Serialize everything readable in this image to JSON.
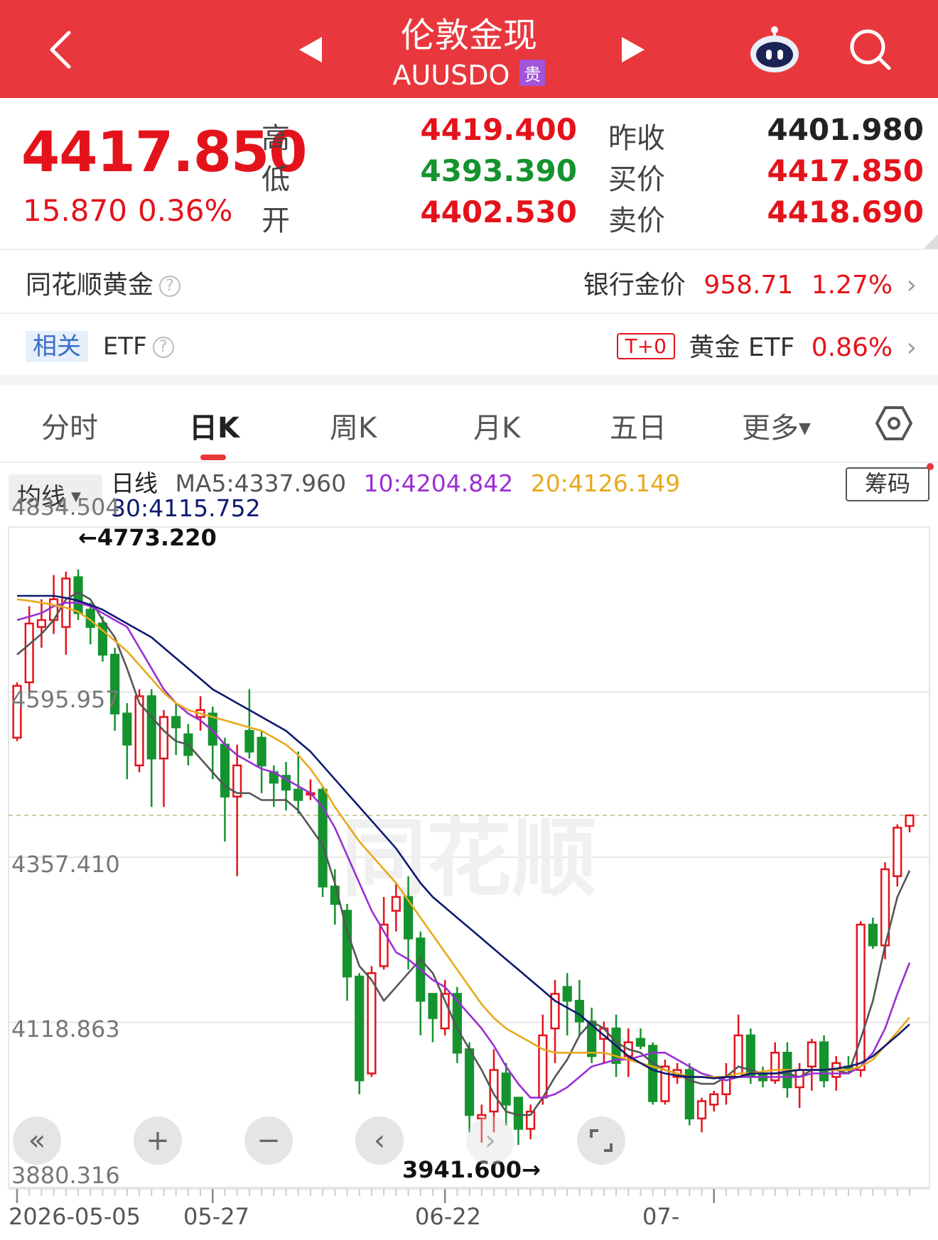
{
  "header": {
    "title": "伦敦金现",
    "symbol": "AUUSDO",
    "tag": "贵"
  },
  "quote": {
    "price": "4417.850",
    "change": "15.870",
    "change_pct": "0.36%",
    "high_label": "高",
    "high": "4419.400",
    "low_label": "低",
    "low": "4393.390",
    "open_label": "开",
    "open": "4402.530",
    "prev_close_label": "昨收",
    "prev_close": "4401.980",
    "bid_label": "买价",
    "bid": "4417.850",
    "ask_label": "卖价",
    "ask": "4418.690"
  },
  "gold_row": {
    "label": "同花顺黄金",
    "bank_label": "银行金价",
    "bank_price": "958.71",
    "bank_pct": "1.27%"
  },
  "etf_row": {
    "tag": "相关",
    "label": "ETF",
    "t0_tag": "T+0",
    "gold_etf_label": "黄金 ETF",
    "gold_etf_pct": "0.86%"
  },
  "tabs": [
    {
      "label": "分时",
      "active": false
    },
    {
      "label": "日K",
      "active": true
    },
    {
      "label": "周K",
      "active": false
    },
    {
      "label": "月K",
      "active": false
    },
    {
      "label": "五日",
      "active": false
    },
    {
      "label": "更多",
      "active": false
    }
  ],
  "chart_header": {
    "ma_selector": "均线",
    "line_label": "日线",
    "ma5": "MA5:4337.960",
    "ma10": "10:4204.842",
    "ma20": "20:4126.149",
    "ma30": "30:4115.752",
    "chips_button": "筹码"
  },
  "colors": {
    "up": "#e4131b",
    "down": "#14932e",
    "header": "#e8383d",
    "ma5": "#555555",
    "ma10": "#9b2fd3",
    "ma20": "#e8a91c",
    "ma30": "#0d1a6e"
  },
  "icons": [
    "back-icon",
    "prev-arrow-icon",
    "next-arrow-icon",
    "robot-icon",
    "search-icon",
    "settings-hexagon-icon",
    "rewind-icon",
    "zoom-in-icon",
    "zoom-out-icon",
    "pan-left-icon",
    "pan-right-icon",
    "fullscreen-icon"
  ],
  "chart_data": {
    "type": "candlestick",
    "y_ticks": [
      "4834.504",
      "4595.957",
      "4357.410",
      "4118.863",
      "3880.316"
    ],
    "ylim": [
      3880.316,
      4834.504
    ],
    "x_tick_labels": [
      "2026-05-05",
      "05-27",
      "06-22",
      "07-"
    ],
    "high_marker": "4773.220",
    "low_marker": "3941.600",
    "current_price": 4417.85,
    "candles": [
      {
        "o": 4530,
        "c": 4605,
        "h": 4610,
        "l": 4525
      },
      {
        "o": 4610,
        "c": 4695,
        "h": 4720,
        "l": 4590
      },
      {
        "o": 4690,
        "c": 4700,
        "h": 4730,
        "l": 4660
      },
      {
        "o": 4700,
        "c": 4730,
        "h": 4765,
        "l": 4680
      },
      {
        "o": 4690,
        "c": 4760,
        "h": 4770,
        "l": 4650
      },
      {
        "o": 4762,
        "c": 4710,
        "h": 4773,
        "l": 4700
      },
      {
        "o": 4715,
        "c": 4690,
        "h": 4725,
        "l": 4665
      },
      {
        "o": 4695,
        "c": 4650,
        "h": 4705,
        "l": 4640
      },
      {
        "o": 4650,
        "c": 4565,
        "h": 4660,
        "l": 4540
      },
      {
        "o": 4565,
        "c": 4520,
        "h": 4580,
        "l": 4470
      },
      {
        "o": 4490,
        "c": 4590,
        "h": 4600,
        "l": 4480
      },
      {
        "o": 4590,
        "c": 4500,
        "h": 4600,
        "l": 4430
      },
      {
        "o": 4500,
        "c": 4560,
        "h": 4570,
        "l": 4430
      },
      {
        "o": 4560,
        "c": 4545,
        "h": 4580,
        "l": 4505
      },
      {
        "o": 4535,
        "c": 4505,
        "h": 4550,
        "l": 4490
      },
      {
        "o": 4560,
        "c": 4570,
        "h": 4590,
        "l": 4540
      },
      {
        "o": 4565,
        "c": 4520,
        "h": 4575,
        "l": 4470
      },
      {
        "o": 4520,
        "c": 4445,
        "h": 4530,
        "l": 4380
      },
      {
        "o": 4445,
        "c": 4490,
        "h": 4520,
        "l": 4330
      },
      {
        "o": 4540,
        "c": 4510,
        "h": 4600,
        "l": 4500
      },
      {
        "o": 4530,
        "c": 4490,
        "h": 4540,
        "l": 4450
      },
      {
        "o": 4480,
        "c": 4465,
        "h": 4490,
        "l": 4430
      },
      {
        "o": 4475,
        "c": 4455,
        "h": 4495,
        "l": 4425
      },
      {
        "o": 4455,
        "c": 4440,
        "h": 4510,
        "l": 4420
      },
      {
        "o": 4450,
        "c": 4450,
        "h": 4470,
        "l": 4440
      },
      {
        "o": 4455,
        "c": 4315,
        "h": 4460,
        "l": 4300
      },
      {
        "o": 4315,
        "c": 4290,
        "h": 4340,
        "l": 4260
      },
      {
        "o": 4280,
        "c": 4185,
        "h": 4290,
        "l": 4150
      },
      {
        "o": 4185,
        "c": 4035,
        "h": 4190,
        "l": 4015
      },
      {
        "o": 4045,
        "c": 4190,
        "h": 4200,
        "l": 4040
      },
      {
        "o": 4200,
        "c": 4260,
        "h": 4300,
        "l": 4195
      },
      {
        "o": 4280,
        "c": 4300,
        "h": 4320,
        "l": 4250
      },
      {
        "o": 4300,
        "c": 4240,
        "h": 4330,
        "l": 4195
      },
      {
        "o": 4240,
        "c": 4150,
        "h": 4250,
        "l": 4100
      },
      {
        "o": 4160,
        "c": 4125,
        "h": 4160,
        "l": 4090
      },
      {
        "o": 4110,
        "c": 4160,
        "h": 4180,
        "l": 4100
      },
      {
        "o": 4160,
        "c": 4075,
        "h": 4170,
        "l": 4060
      },
      {
        "o": 4080,
        "c": 3985,
        "h": 4090,
        "l": 3960
      },
      {
        "o": 3980,
        "c": 3985,
        "h": 4000,
        "l": 3945
      },
      {
        "o": 3990,
        "c": 4050,
        "h": 4080,
        "l": 3960
      },
      {
        "o": 4045,
        "c": 4000,
        "h": 4060,
        "l": 3970
      },
      {
        "o": 4010,
        "c": 3965,
        "h": 4010,
        "l": 3941.6
      },
      {
        "o": 3965,
        "c": 3990,
        "h": 4000,
        "l": 3950
      },
      {
        "o": 4010,
        "c": 4100,
        "h": 4130,
        "l": 4000
      },
      {
        "o": 4110,
        "c": 4160,
        "h": 4180,
        "l": 4060
      },
      {
        "o": 4170,
        "c": 4150,
        "h": 4190,
        "l": 4100
      },
      {
        "o": 4150,
        "c": 4120,
        "h": 4180,
        "l": 4100
      },
      {
        "o": 4120,
        "c": 4070,
        "h": 4140,
        "l": 4060
      },
      {
        "o": 4095,
        "c": 4110,
        "h": 4120,
        "l": 4060
      },
      {
        "o": 4110,
        "c": 4060,
        "h": 4130,
        "l": 4040
      },
      {
        "o": 4070,
        "c": 4090,
        "h": 4110,
        "l": 4040
      },
      {
        "o": 4095,
        "c": 4085,
        "h": 4110,
        "l": 4080
      },
      {
        "o": 4085,
        "c": 4005,
        "h": 4090,
        "l": 4000
      },
      {
        "o": 4005,
        "c": 4055,
        "h": 4065,
        "l": 4000
      },
      {
        "o": 4040,
        "c": 4050,
        "h": 4060,
        "l": 4030
      },
      {
        "o": 4050,
        "c": 3980,
        "h": 4060,
        "l": 3970
      },
      {
        "o": 3980,
        "c": 4005,
        "h": 4010,
        "l": 3960
      },
      {
        "o": 4000,
        "c": 4015,
        "h": 4020,
        "l": 3990
      },
      {
        "o": 4015,
        "c": 4040,
        "h": 4060,
        "l": 4000
      },
      {
        "o": 4040,
        "c": 4100,
        "h": 4130,
        "l": 4040
      },
      {
        "o": 4100,
        "c": 4040,
        "h": 4110,
        "l": 4030
      },
      {
        "o": 4045,
        "c": 4035,
        "h": 4055,
        "l": 4025
      },
      {
        "o": 4035,
        "c": 4075,
        "h": 4090,
        "l": 4030
      },
      {
        "o": 4075,
        "c": 4025,
        "h": 4090,
        "l": 4010
      },
      {
        "o": 4025,
        "c": 4050,
        "h": 4060,
        "l": 3995
      },
      {
        "o": 4055,
        "c": 4090,
        "h": 4095,
        "l": 4020
      },
      {
        "o": 4090,
        "c": 4035,
        "h": 4100,
        "l": 4025
      },
      {
        "o": 4040,
        "c": 4060,
        "h": 4070,
        "l": 4020
      },
      {
        "o": 4055,
        "c": 4050,
        "h": 4070,
        "l": 4045
      },
      {
        "o": 4050,
        "c": 4260,
        "h": 4265,
        "l": 4040
      },
      {
        "o": 4260,
        "c": 4230,
        "h": 4270,
        "l": 4225
      },
      {
        "o": 4230,
        "c": 4340,
        "h": 4350,
        "l": 4210
      },
      {
        "o": 4330,
        "c": 4400,
        "h": 4405,
        "l": 4315
      },
      {
        "o": 4402.53,
        "c": 4417.85,
        "h": 4419.4,
        "l": 4393.39
      }
    ],
    "ma_series": [
      {
        "name": "MA5",
        "values": [
          4650,
          4665,
          4680,
          4700,
          4730,
          4740,
          4730,
          4700,
          4675,
          4630,
          4580,
          4560,
          4540,
          4525,
          4520,
          4500,
          4480,
          4460,
          4450,
          4450,
          4440,
          4440,
          4440,
          4425,
          4400,
          4375,
          4320,
          4250,
          4200,
          4180,
          4150,
          4170,
          4190,
          4210,
          4190,
          4150,
          4110,
          4080,
          4050,
          4015,
          3990,
          3985,
          3985,
          4010,
          4040,
          4065,
          4100,
          4120,
          4110,
          4090,
          4080,
          4075,
          4060,
          4050,
          4045,
          4035,
          4030,
          4030,
          4040,
          4055,
          4050,
          4045,
          4045,
          4045,
          4040,
          4050,
          4050,
          4050,
          4045,
          4095,
          4150,
          4230,
          4300,
          4338
        ]
      },
      {
        "name": "10",
        "values": [
          4700,
          4705,
          4710,
          4720,
          4725,
          4725,
          4720,
          4710,
          4700,
          4690,
          4660,
          4630,
          4600,
          4580,
          4565,
          4555,
          4540,
          4520,
          4505,
          4495,
          4485,
          4480,
          4470,
          4460,
          4450,
          4430,
          4400,
          4360,
          4320,
          4280,
          4250,
          4220,
          4210,
          4195,
          4180,
          4170,
          4150,
          4130,
          4110,
          4085,
          4055,
          4030,
          4010,
          4010,
          4015,
          4025,
          4040,
          4055,
          4060,
          4065,
          4065,
          4070,
          4075,
          4075,
          4065,
          4055,
          4045,
          4040,
          4035,
          4040,
          4040,
          4040,
          4040,
          4040,
          4040,
          4045,
          4045,
          4045,
          4045,
          4055,
          4075,
          4110,
          4160,
          4205
        ]
      },
      {
        "name": "20",
        "values": [
          4730,
          4728,
          4725,
          4722,
          4718,
          4712,
          4700,
          4685,
          4670,
          4655,
          4635,
          4615,
          4595,
          4580,
          4570,
          4565,
          4560,
          4555,
          4550,
          4545,
          4540,
          4530,
          4520,
          4505,
          4485,
          4460,
          4430,
          4405,
          4380,
          4360,
          4340,
          4320,
          4295,
          4270,
          4245,
          4220,
          4195,
          4170,
          4145,
          4125,
          4110,
          4100,
          4090,
          4080,
          4075,
          4075,
          4075,
          4075,
          4075,
          4070,
          4065,
          4060,
          4055,
          4050,
          4045,
          4040,
          4040,
          4040,
          4040,
          4045,
          4045,
          4048,
          4050,
          4050,
          4050,
          4050,
          4050,
          4050,
          4050,
          4055,
          4065,
          4085,
          4105,
          4126
        ]
      },
      {
        "name": "30",
        "values": [
          4735,
          4735,
          4735,
          4735,
          4732,
          4728,
          4722,
          4715,
          4705,
          4695,
          4685,
          4675,
          4660,
          4645,
          4630,
          4615,
          4600,
          4590,
          4580,
          4570,
          4560,
          4550,
          4540,
          4525,
          4510,
          4490,
          4470,
          4450,
          4430,
          4410,
          4390,
          4370,
          4345,
          4320,
          4300,
          4285,
          4270,
          4255,
          4240,
          4225,
          4210,
          4195,
          4180,
          4165,
          4150,
          4140,
          4130,
          4115,
          4100,
          4085,
          4070,
          4060,
          4050,
          4045,
          4042,
          4040,
          4040,
          4038,
          4040,
          4040,
          4045,
          4045,
          4045,
          4048,
          4050,
          4050,
          4050,
          4052,
          4055,
          4060,
          4070,
          4085,
          4100,
          4116
        ]
      }
    ]
  }
}
